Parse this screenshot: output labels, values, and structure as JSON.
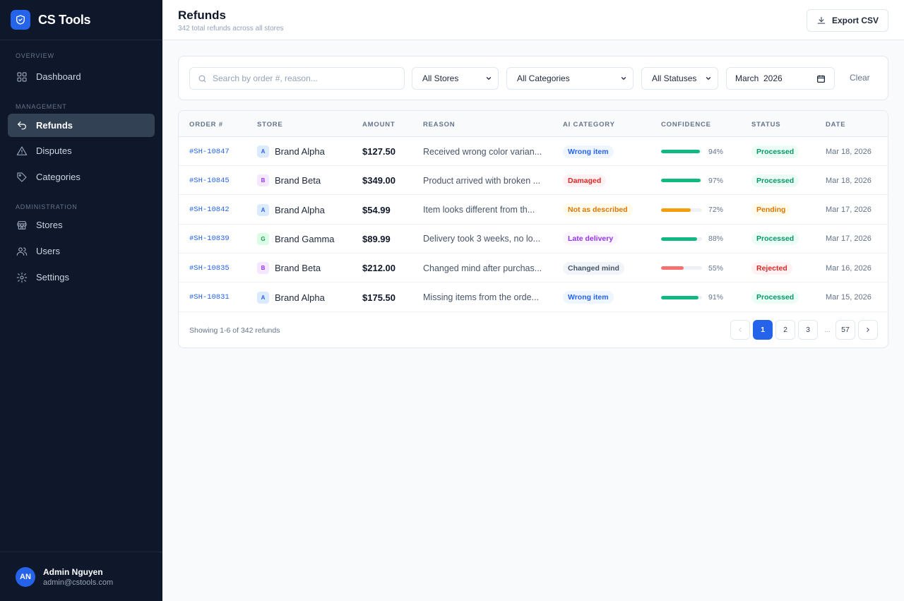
{
  "app": {
    "name": "CS Tools"
  },
  "sidebar": {
    "sections": [
      {
        "label": "OVERVIEW"
      },
      {
        "label": "MANAGEMENT"
      },
      {
        "label": "ADMINISTRATION"
      }
    ],
    "items": [
      {
        "label": "Dashboard",
        "icon": "grid-icon"
      },
      {
        "label": "Refunds",
        "icon": "undo-arrow-icon",
        "active": true
      },
      {
        "label": "Disputes",
        "icon": "warning-triangle-icon"
      },
      {
        "label": "Categories",
        "icon": "tag-icon"
      },
      {
        "label": "Stores",
        "icon": "store-icon"
      },
      {
        "label": "Users",
        "icon": "users-icon"
      },
      {
        "label": "Settings",
        "icon": "gear-icon"
      }
    ]
  },
  "user": {
    "initials": "AN",
    "name": "Admin Nguyen",
    "email": "admin@cstools.com"
  },
  "header": {
    "title": "Refunds",
    "subtitle": "342 total refunds across all stores",
    "export_label": "Export CSV"
  },
  "filters": {
    "search_placeholder": "Search by order #, reason...",
    "store": "All Stores",
    "category": "All Categories",
    "status": "All Statuses",
    "month": "March  2026",
    "clear_label": "Clear"
  },
  "table": {
    "columns": [
      "ORDER #",
      "STORE",
      "AMOUNT",
      "REASON",
      "AI CATEGORY",
      "CONFIDENCE",
      "STATUS",
      "DATE"
    ],
    "rows": [
      {
        "order": "#SH-10847",
        "store_initial": "A",
        "store": "Brand Alpha",
        "amount": "$127.50",
        "reason": "Received wrong color varian...",
        "category": "Wrong item",
        "confidence": "94%",
        "status": "Processed",
        "date": "Mar 18, 2026"
      },
      {
        "order": "#SH-10845",
        "store_initial": "B",
        "store": "Brand Beta",
        "amount": "$349.00",
        "reason": "Product arrived with broken ...",
        "category": "Damaged",
        "confidence": "97%",
        "status": "Processed",
        "date": "Mar 18, 2026"
      },
      {
        "order": "#SH-10842",
        "store_initial": "A",
        "store": "Brand Alpha",
        "amount": "$54.99",
        "reason": "Item looks different from th...",
        "category": "Not as described",
        "confidence": "72%",
        "status": "Pending",
        "date": "Mar 17, 2026"
      },
      {
        "order": "#SH-10839",
        "store_initial": "G",
        "store": "Brand Gamma",
        "amount": "$89.99",
        "reason": "Delivery took 3 weeks, no lo...",
        "category": "Late delivery",
        "confidence": "88%",
        "status": "Processed",
        "date": "Mar 17, 2026"
      },
      {
        "order": "#SH-10835",
        "store_initial": "B",
        "store": "Brand Beta",
        "amount": "$212.00",
        "reason": "Changed mind after purchas...",
        "category": "Changed mind",
        "confidence": "55%",
        "status": "Rejected",
        "date": "Mar 16, 2026"
      },
      {
        "order": "#SH-10831",
        "store_initial": "A",
        "store": "Brand Alpha",
        "amount": "$175.50",
        "reason": "Missing items from the orde...",
        "category": "Wrong item",
        "confidence": "91%",
        "status": "Processed",
        "date": "Mar 15, 2026"
      }
    ]
  },
  "pagination": {
    "showing": "Showing 1-6 of 342 refunds",
    "pages": [
      "1",
      "2",
      "3",
      "57"
    ],
    "ellipsis": "...",
    "current": "1"
  },
  "colors": {
    "accent": "#2563eb",
    "sidebar_bg": "#0f172a",
    "success": "#10b981",
    "warning": "#f59e0b",
    "danger": "#f87171"
  }
}
